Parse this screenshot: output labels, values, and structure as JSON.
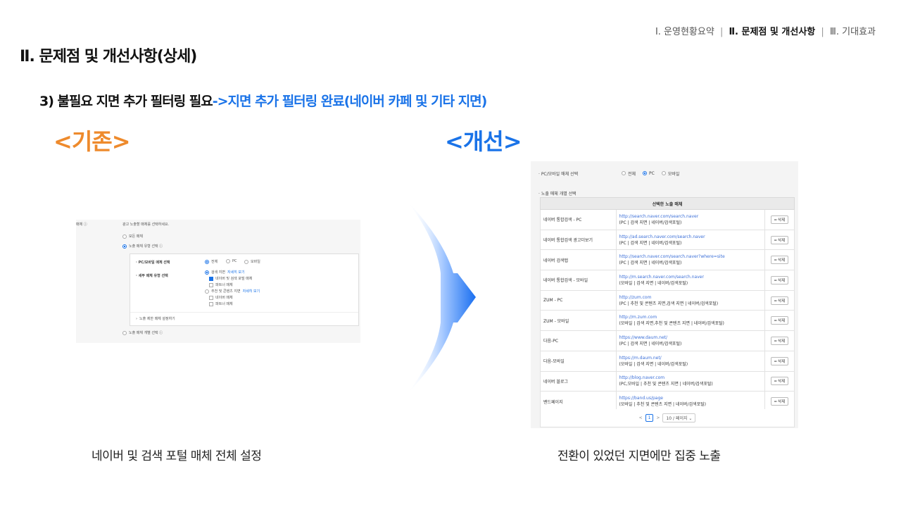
{
  "nav": {
    "item1": "Ⅰ. 운영현황요약",
    "item2": "Ⅱ. 문제점 및 개선사항",
    "item3": "Ⅲ. 기대효과",
    "sep": "|"
  },
  "page_title": "Ⅱ. 문제점 및 개선사항(상세)",
  "subtitle": {
    "black": "3) 불필요 지면 추가 필터링 필요",
    "blue": "->지면 추가 필터링 완료(네이버 카페 및 기타 지면)"
  },
  "before_label": "<기존>",
  "after_label": "<개선>",
  "captions": {
    "left": "네이버 및 검색 포털 매체 전체 설정",
    "right": "전환이 있었던 지면에만 집중 노출"
  },
  "colors": {
    "orange": "#ee8a2c",
    "blue": "#1a73e8"
  },
  "left_panel": {
    "header": "매체 ⓘ",
    "hint": "광고 노출할 매체를 선택하세요.",
    "opt_all": "모든 매체",
    "opt_type": "노출 매체 유형 선택 ⓘ",
    "pc_mobile_label": "· PC/모바일 매체 선택",
    "pc_mobile_options": [
      "전체",
      "PC",
      "모바일"
    ],
    "detail_label": "· 세부 매체 유형 선택",
    "search_page": "검색 지면",
    "detail_link": "자세히 보기",
    "naver_search": "네이버 및 검색 포털 매체",
    "partner": "파트너 매체",
    "content_page": "추천 및 콘텐츠 지면",
    "naver_media": "네이버 매체",
    "partner2": "파트너 매체",
    "exclude": "노출 제한 매체 설정하기",
    "opt_individual": "노출 매체 개별 선택 ⓘ"
  },
  "right_panel": {
    "pc_mobile_label": "· PC/모바일 매체 선택",
    "options": [
      "전체",
      "PC",
      "모바일"
    ],
    "section_label": "· 노출 매체 개별 선택",
    "table_header": "선택한 노출 매체",
    "delete_label": "━ 삭제",
    "rows": [
      {
        "name": "네이버 통합검색 - PC",
        "url": "http://search.naver.com/search.naver",
        "desc": "(PC | 검색 지면 | 네이버/검색포털)"
      },
      {
        "name": "네이버 통합검색 광고더보기",
        "url": "http://ad.search.naver.com/search.naver",
        "desc": "(PC | 검색 지면 | 네이버/검색포털)"
      },
      {
        "name": "네이버 검색탭",
        "url": "http://search.naver.com/search.naver?where=site",
        "desc": "(PC | 검색 지면 | 네이버/검색포털)"
      },
      {
        "name": "네이버 통합검색 - 모바일",
        "url": "http://m.search.naver.com/search.naver",
        "desc": "(모바일 | 검색 지면 | 네이버/검색포털)"
      },
      {
        "name": "ZUM - PC",
        "url": "http://zum.com",
        "desc": "(PC | 추천 및 콘텐츠 지면,검색 지면 | 네이버/검색포털)"
      },
      {
        "name": "ZUM - 모바일",
        "url": "http://m.zum.com",
        "desc": "(모바일 | 검색 지면,추천 및 콘텐츠 지면 | 네이버/검색포털)"
      },
      {
        "name": "다음-PC",
        "url": "https://www.daum.net/",
        "desc": "(PC | 검색 지면 | 네이버/검색포털)"
      },
      {
        "name": "다음-모바일",
        "url": "https://m.daum.net/",
        "desc": "(모바일 | 검색 지면 | 네이버/검색포털)"
      },
      {
        "name": "네이버 블로그",
        "url": "http://blog.naver.com",
        "desc": "(PC,모바일 | 추천 및 콘텐츠 지면 | 네이버/검색포털)"
      },
      {
        "name": "밴드페이지",
        "url": "https://band.us/page",
        "desc": "(모바일 | 추천 및 콘텐츠 지면 | 네이버/검색포털)"
      }
    ],
    "pager": {
      "prev": "<",
      "current": "1",
      "next": ">",
      "size": "10 / 페이지 ⌄"
    }
  }
}
